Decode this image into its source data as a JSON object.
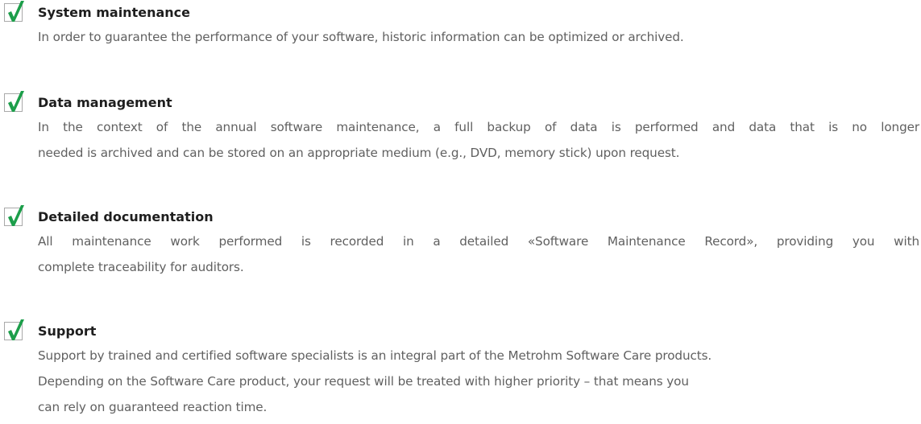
{
  "colors": {
    "check_green": "#1c9e4a",
    "check_box": "#a9a9a9",
    "title": "#1e1e1e",
    "body": "#606060"
  },
  "items": [
    {
      "icon": "check-icon",
      "title": "System maintenance",
      "lines": [
        "In order to guarantee the performance of your software, historic information can be optimized or archived."
      ]
    },
    {
      "icon": "check-icon",
      "title": "Data management",
      "lines": [
        "In the context of the annual software maintenance, a full backup of data is performed and data that is no longer",
        "needed is archived and can be stored on an appropriate medium (e.g., DVD, memory stick) upon request."
      ]
    },
    {
      "icon": "check-icon",
      "title": "Detailed documentation",
      "lines": [
        "All maintenance work performed is recorded in a detailed «Software Maintenance Record», providing you with",
        "complete traceability for auditors."
      ]
    },
    {
      "icon": "check-icon",
      "title": "Support",
      "lines": [
        "Support by trained and certified software specialists is an integral part of the Metrohm Software Care products.",
        "Depending on the Software Care product, your request will be treated with higher priority – that means you",
        "can rely on guaranteed reaction time."
      ]
    }
  ]
}
